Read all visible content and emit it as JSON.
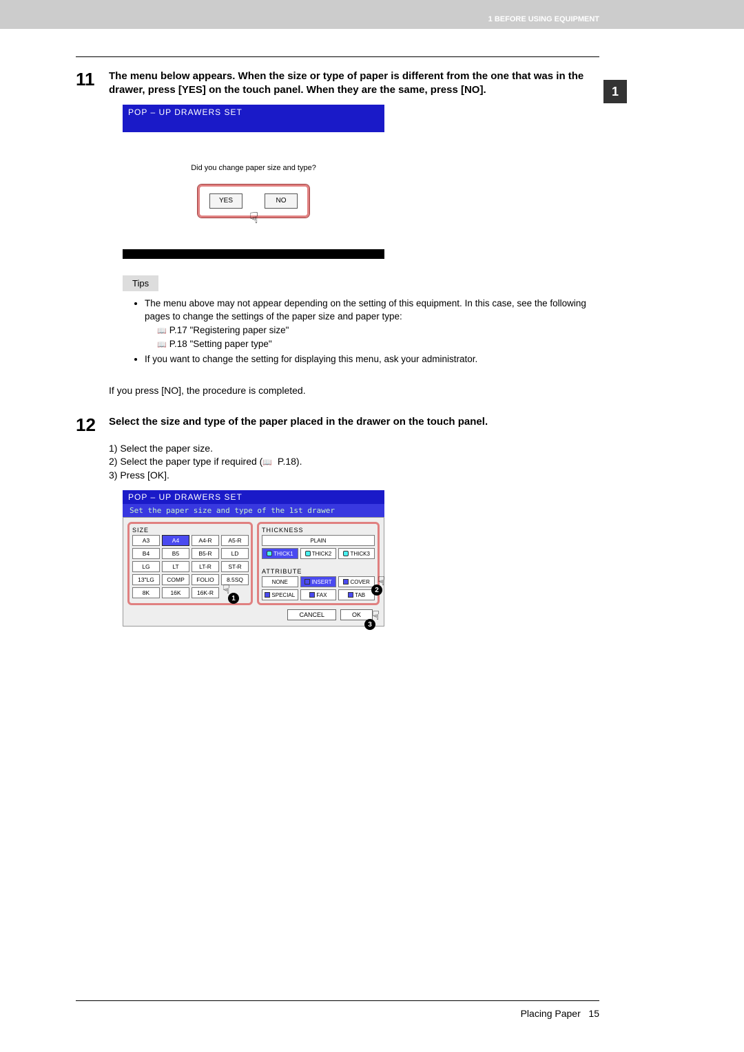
{
  "header": {
    "section": "1 BEFORE USING EQUIPMENT",
    "chapter_tab": "1"
  },
  "step11": {
    "num": "11",
    "title": "The menu below appears. When the size or type of paper is different from the one that was in the drawer, press [YES] on the touch panel. When they are the same, press [NO].",
    "popup": {
      "title": "POP – UP DRAWERS  SET",
      "message": "Did you change paper size and type?",
      "yes": "YES",
      "no": "NO"
    },
    "tips_label": "Tips",
    "tips": {
      "t1": "The menu above may not appear depending on the setting of this equipment. In this case, see the following pages to change the settings of the paper size and paper type:",
      "ref1": "P.17 \"Registering paper size\"",
      "ref2": "P.18 \"Setting paper type\"",
      "t2": "If you want to change the setting for displaying this menu, ask your administrator."
    },
    "completed": "If you press [NO], the procedure is completed."
  },
  "step12": {
    "num": "12",
    "title": "Select the size and type of the paper placed in the drawer on the touch panel.",
    "sub": {
      "s1": "1)  Select the paper size.",
      "s2_a": "2)  Select the paper type if required (",
      "s2_b": " P.18).",
      "s3": "3)  Press [OK]."
    },
    "popup": {
      "title": "POP – UP DRAWERS  SET",
      "subtitle": "Set the paper size and type of the 1st drawer",
      "size_label": "SIZE",
      "thick_label": "THICKNESS",
      "attr_label": "ATTRIBUTE",
      "sizes": [
        "A3",
        "A4",
        "A4-R",
        "A5-R",
        "B4",
        "B5",
        "B5-R",
        "LD",
        "LG",
        "LT",
        "LT-R",
        "ST-R",
        "13\"LG",
        "COMP",
        "FOLIO",
        "8.5SQ",
        "8K",
        "16K",
        "16K-R"
      ],
      "selected_size": "A4",
      "thick": [
        "PLAIN",
        "THICK1",
        "THICK2",
        "THICK3"
      ],
      "selected_thick": "THICK1",
      "attrs": [
        "NONE",
        "INSERT",
        "COVER",
        "SPECIAL",
        "FAX",
        "TAB"
      ],
      "selected_attr": "INSERT",
      "cancel": "CANCEL",
      "ok": "OK"
    }
  },
  "footer": {
    "section": "Placing Paper",
    "page": "15"
  }
}
